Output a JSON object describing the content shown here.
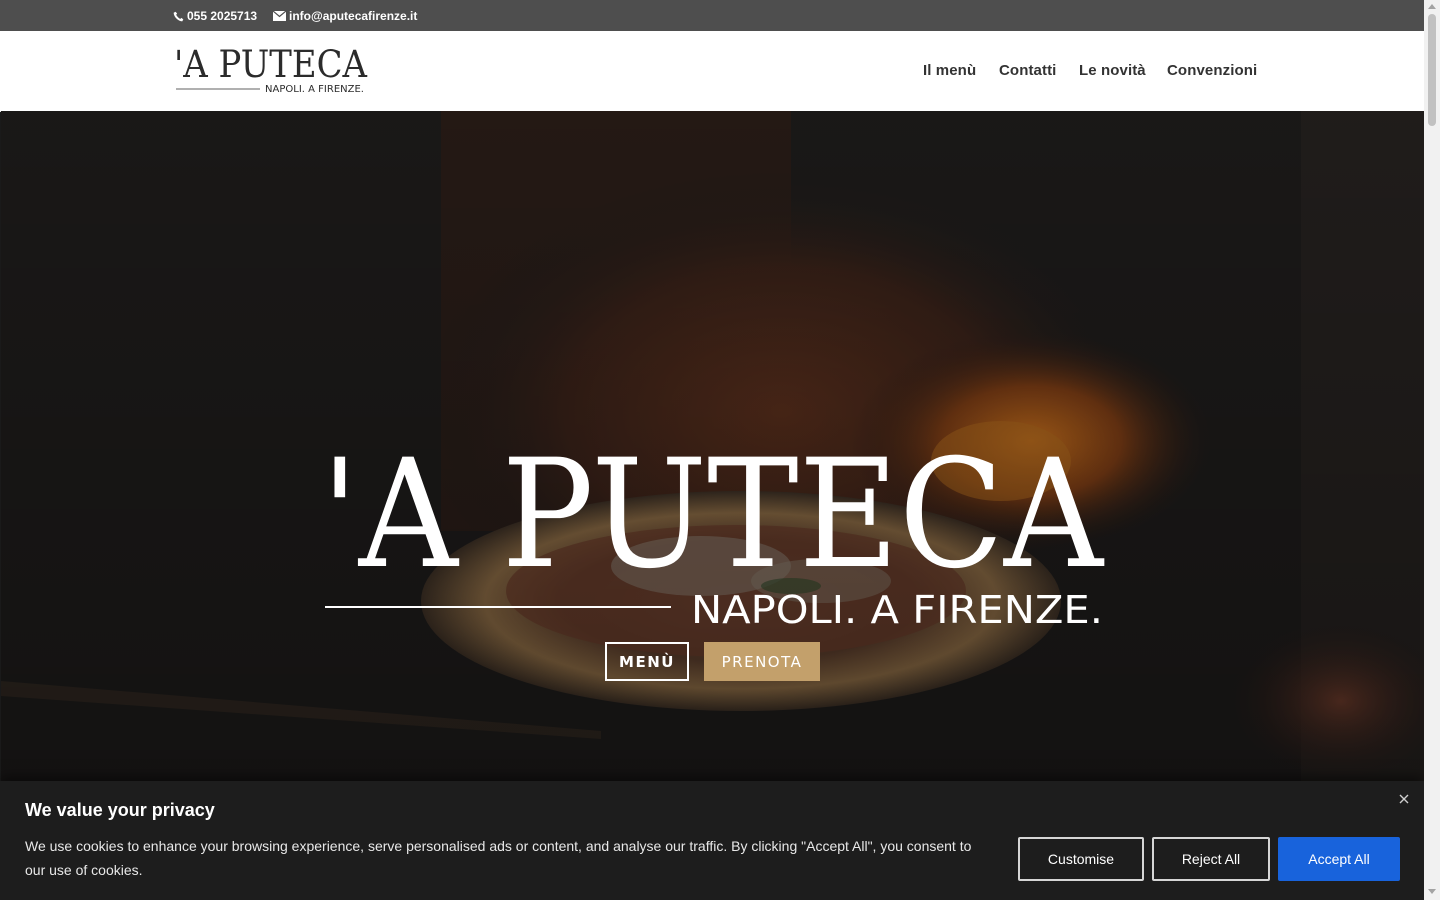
{
  "topbar": {
    "phone": "055 2025713",
    "email": "info@aputecafirenze.it",
    "phone_icon": "phone-icon",
    "email_icon": "envelope-icon"
  },
  "header": {
    "logo": {
      "main": "'A PUTECA",
      "sub": "NAPOLI. A FIRENZE."
    },
    "nav": [
      {
        "label": "Il menù"
      },
      {
        "label": "Contatti"
      },
      {
        "label": "Le novità"
      },
      {
        "label": "Convenzioni"
      }
    ]
  },
  "hero": {
    "logo_main": "'A PUTECA",
    "logo_sub": "NAPOLI. A FIRENZE.",
    "buttons": {
      "menu": "MENÙ",
      "prenota": "PRENOTA"
    },
    "colors": {
      "accent": "#c3a06b"
    }
  },
  "cookie": {
    "title": "We value your privacy",
    "text": "We use cookies to enhance your browsing experience, serve personalised ads or content, and analyse our traffic. By clicking \"Accept All\", you consent to our use of cookies.",
    "buttons": {
      "customise": "Customise",
      "reject": "Reject All",
      "accept": "Accept All"
    },
    "close_icon": "close-icon",
    "colors": {
      "accept": "#1863dc"
    }
  }
}
